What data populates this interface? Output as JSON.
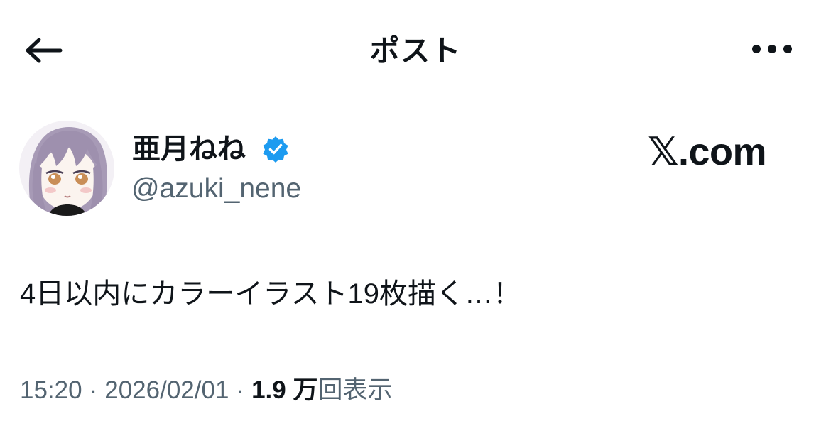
{
  "header": {
    "title": "ポスト",
    "back_icon": "arrow-left-icon",
    "more_icon": "more-horizontal-icon"
  },
  "author": {
    "display_name": "亜月ねね",
    "handle": "@azuki_nene",
    "verified": true,
    "verified_color": "#1d9bf0"
  },
  "watermark": {
    "text": "𝕏.com"
  },
  "post": {
    "text": "4日以内にカラーイラスト19枚描く…！"
  },
  "meta": {
    "time": "15:20",
    "separator": "·",
    "date": "2026/02/01",
    "views_count": "1.9 万",
    "views_label": "回表示"
  },
  "colors": {
    "text_primary": "#0f1419",
    "text_secondary": "#536471",
    "background": "#ffffff"
  }
}
